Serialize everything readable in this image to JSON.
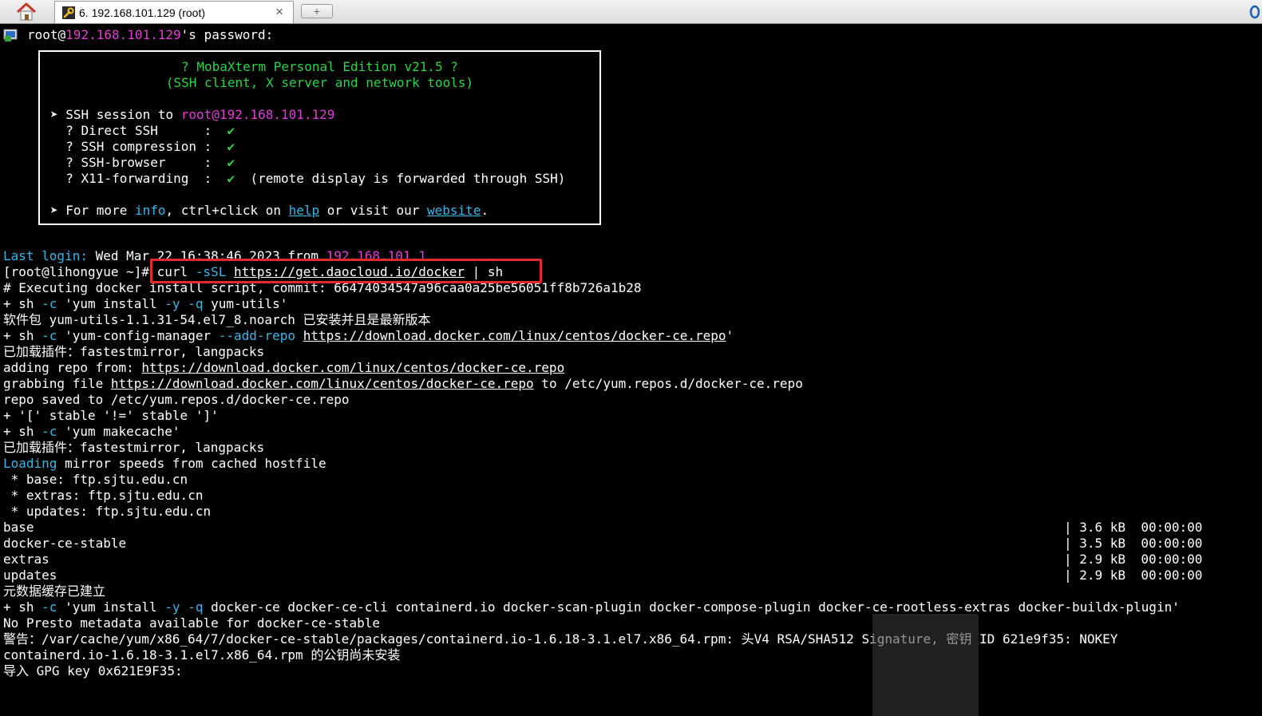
{
  "tab": {
    "title": "6. 192.168.101.129 (root)",
    "close_glyph": "×",
    "new_tab_glyph": "+"
  },
  "prompt": {
    "user": "root@",
    "host": "192.168.101.129",
    "suffix": "'s password:"
  },
  "banner": {
    "title": "? MobaXterm Personal Edition v21.5 ?",
    "subtitle": "(SSH client, X server and network tools)",
    "session_prefix": "➤ SSH session to ",
    "session_target": "root@192.168.101.129",
    "features": [
      {
        "label": "  ? Direct SSH      :  ",
        "check": "✔",
        "note": ""
      },
      {
        "label": "  ? SSH compression :  ",
        "check": "✔",
        "note": ""
      },
      {
        "label": "  ? SSH-browser     :  ",
        "check": "✔",
        "note": ""
      },
      {
        "label": "  ? X11-forwarding  :  ",
        "check": "✔",
        "note": "  (remote display is forwarded through SSH)"
      }
    ],
    "more_prefix": "➤ For more ",
    "info": "info",
    "more_mid": ", ctrl+click on ",
    "help": "help",
    "more_mid2": " or visit our ",
    "website": "website",
    "more_end": "."
  },
  "last_login": {
    "label": "Last login:",
    "text": " Wed Mar 22 16:38:46 2023 from ",
    "ip": "192.168.101.1"
  },
  "command": {
    "prompt": "[root@lihongyue ~]# ",
    "curl": "curl ",
    "flag": "-sSL",
    "url": "https://get.daocloud.io/docker",
    "pipe": " | sh"
  },
  "output": {
    "executing": "# Executing docker install script, commit: 66474034547a96caa0a25be56051ff8b726a1b28",
    "sh1_a": "+ sh ",
    "sh1_flag": "-c",
    "sh1_b": " 'yum install ",
    "sh1_y": "-y",
    "sh1_sp": " ",
    "sh1_q": "-q",
    "sh1_c": " yum-utils'",
    "pkg_installed": "软件包 yum-utils-1.1.31-54.el7_8.noarch 已安装并且是最新版本",
    "sh2_a": "+ sh ",
    "sh2_flag": "-c",
    "sh2_b": " 'yum-config-manager ",
    "sh2_add": "--add-repo",
    "sh2_sp": " ",
    "sh2_url": "https://download.docker.com/linux/centos/docker-ce.repo",
    "sh2_end": "'",
    "plugins1": "已加载插件：fastestmirror, langpacks",
    "adding_repo": "adding repo from: ",
    "adding_url": "https://download.docker.com/linux/centos/docker-ce.repo",
    "grabbing": "grabbing file ",
    "grabbing_url": "https://download.docker.com/linux/centos/docker-ce.repo",
    "grabbing_end": " to /etc/yum.repos.d/docker-ce.repo",
    "repo_saved": "repo saved to /etc/yum.repos.d/docker-ce.repo",
    "stable_check": "+ '[' stable '!=' stable ']'",
    "sh3_a": "+ sh ",
    "sh3_flag": "-c",
    "sh3_b": " 'yum makecache'",
    "plugins2": "已加载插件：fastestmirror, langpacks",
    "loading": "Loading",
    "loading_rest": " mirror speeds from cached hostfile",
    "mirror_base": " * base: ftp.sjtu.edu.cn",
    "mirror_extras": " * extras: ftp.sjtu.edu.cn",
    "mirror_updates": " * updates: ftp.sjtu.edu.cn",
    "repos": [
      {
        "name": "base",
        "stats": "| 3.6 kB  00:00:00"
      },
      {
        "name": "docker-ce-stable",
        "stats": "| 3.5 kB  00:00:00"
      },
      {
        "name": "extras",
        "stats": "| 2.9 kB  00:00:00"
      },
      {
        "name": "updates",
        "stats": "| 2.9 kB  00:00:00"
      }
    ],
    "metadata_built": "元数据缓存已建立",
    "sh4_a": "+ sh ",
    "sh4_flag": "-c",
    "sh4_b": " 'yum install ",
    "sh4_y": "-y",
    "sh4_sp": " ",
    "sh4_q": "-q",
    "sh4_c": " docker-ce docker-ce-cli containerd.io docker-scan-plugin docker-compose-plugin docker-ce-rootless-extras docker-buildx-plugin'",
    "no_presto": "No Presto metadata available for docker-ce-stable",
    "warning": "警告：/var/cache/yum/x86_64/7/docker-ce-stable/packages/containerd.io-1.6.18-3.1.el7.x86_64.rpm: 头V4 RSA/SHA512 Signature, 密钥 ID 621e9f35: NOKEY",
    "not_installed": "containerd.io-1.6.18-3.1.el7.x86_64.rpm 的公钥尚未安装",
    "import_gpg": "导入 GPG key 0x621E9F35:"
  },
  "colors": {
    "background": "#000000",
    "foreground": "#ffffff",
    "cyan": "#3db5e6",
    "magenta": "#e23fd6",
    "green": "#2ed34a",
    "highlight_box": "#e12a2a"
  }
}
